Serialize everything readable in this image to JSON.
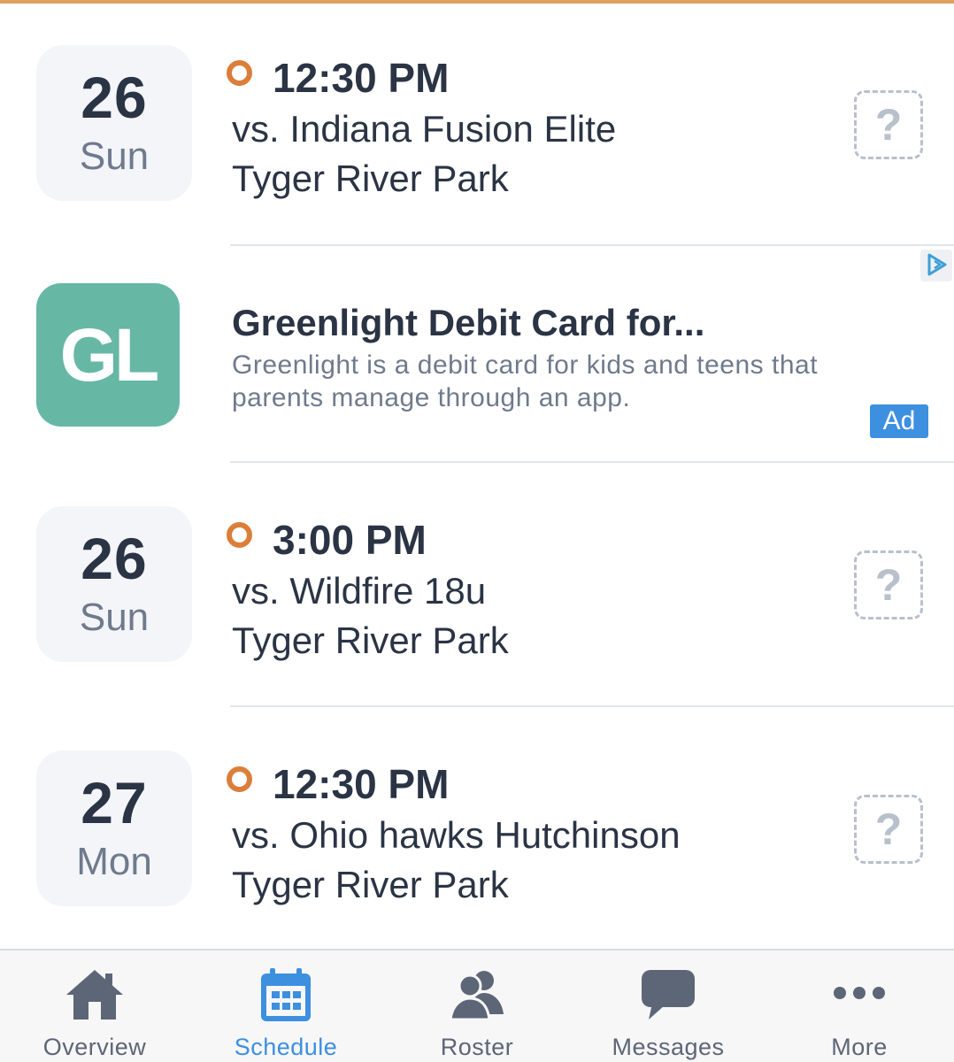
{
  "colors": {
    "accent": "#3d8fe0",
    "status_dot": "#db7e3a",
    "ad_logo_bg": "#67b7a5",
    "text_primary": "#2b3444",
    "text_secondary": "#6f7a8c"
  },
  "events": [
    {
      "day": "26",
      "weekday": "Sun",
      "time": "12:30 PM",
      "opponent": "vs. Indiana Fusion Elite",
      "location": "Tyger River Park",
      "rsvp_symbol": "?",
      "status_icon": "pending-circle-icon",
      "rsvp_icon": "question-icon"
    },
    {
      "day": "26",
      "weekday": "Sun",
      "time": "3:00 PM",
      "opponent": "vs. Wildfire 18u",
      "location": "Tyger River Park",
      "rsvp_symbol": "?",
      "status_icon": "pending-circle-icon",
      "rsvp_icon": "question-icon"
    },
    {
      "day": "27",
      "weekday": "Mon",
      "time": "12:30 PM",
      "opponent": "vs. Ohio hawks Hutchinson",
      "location": "Tyger River Park",
      "rsvp_symbol": "?",
      "status_icon": "pending-circle-icon",
      "rsvp_icon": "question-icon"
    }
  ],
  "ad": {
    "logo_text": "GL",
    "title": "Greenlight Debit Card for...",
    "description": "Greenlight is a debit card for kids and teens that parents manage through an app.",
    "badge": "Ad",
    "choices_icon": "adchoices-icon"
  },
  "tabbar": {
    "active": "Schedule",
    "tabs": [
      {
        "label": "Overview",
        "icon": "home-icon"
      },
      {
        "label": "Schedule",
        "icon": "calendar-icon"
      },
      {
        "label": "Roster",
        "icon": "people-icon"
      },
      {
        "label": "Messages",
        "icon": "chat-bubble-icon"
      },
      {
        "label": "More",
        "icon": "ellipsis-icon"
      }
    ]
  }
}
